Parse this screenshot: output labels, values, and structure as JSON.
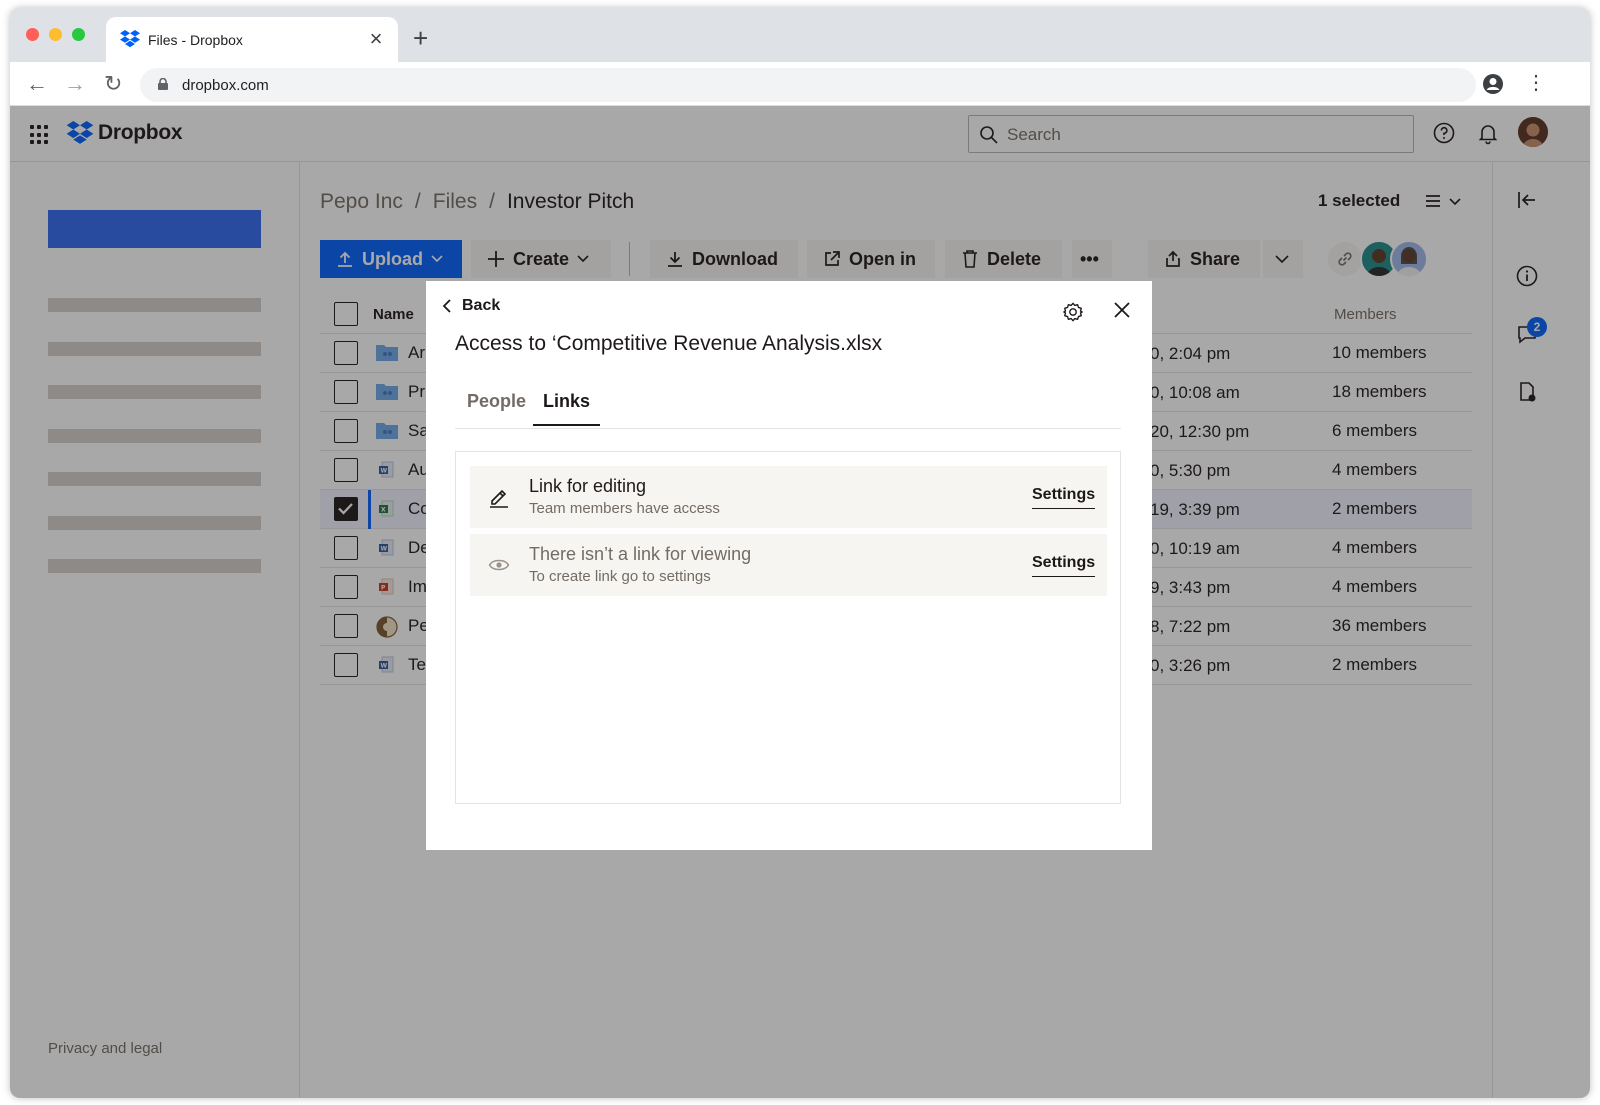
{
  "browser": {
    "tab_title": "Files - Dropbox",
    "tab_close": "×",
    "new_tab": "+",
    "url": "dropbox.com",
    "back": "←",
    "forward": "→",
    "reload": "↻",
    "menu": "⋮"
  },
  "app": {
    "brand": "Dropbox",
    "search_placeholder": "Search",
    "privacy": "Privacy and legal"
  },
  "breadcrumb": {
    "items": [
      "Pepo Inc",
      "Files",
      "Investor Pitch"
    ],
    "separator": "/"
  },
  "selection": {
    "label": "1 selected"
  },
  "toolbar": {
    "upload": "Upload",
    "create": "Create",
    "download": "Download",
    "open_in": "Open in",
    "delete": "Delete",
    "more": "•••",
    "share": "Share"
  },
  "table": {
    "col_name": "Name",
    "col_members": "Members",
    "rows": [
      {
        "name": "Ar",
        "type": "folder",
        "date": "0, 2:04 pm",
        "members": "10 members",
        "checked": false
      },
      {
        "name": "Pr",
        "type": "folder",
        "date": "0, 10:08 am",
        "members": "18 members",
        "checked": false
      },
      {
        "name": "Sa",
        "type": "folder",
        "date": "20, 12:30 pm",
        "members": "6 members",
        "checked": false
      },
      {
        "name": "Au",
        "type": "word",
        "date": "0, 5:30 pm",
        "members": "4 members",
        "checked": false
      },
      {
        "name": "Co",
        "type": "excel",
        "date": "19, 3:39 pm",
        "members": "2 members",
        "checked": true
      },
      {
        "name": "De",
        "type": "word",
        "date": "0, 10:19 am",
        "members": "4 members",
        "checked": false
      },
      {
        "name": "Im",
        "type": "ppt",
        "date": "9, 3:43 pm",
        "members": "4 members",
        "checked": false
      },
      {
        "name": "Pe",
        "type": "pepo",
        "date": "8, 7:22 pm",
        "members": "36 members",
        "checked": false
      },
      {
        "name": "Te",
        "type": "word",
        "date": "0, 3:26 pm",
        "members": "2 members",
        "checked": false
      }
    ]
  },
  "rail": {
    "comments_count": "2"
  },
  "modal": {
    "back": "Back",
    "title": "Access to ‘Competitive Revenue Analysis.xlsx",
    "tabs": [
      {
        "label": "People",
        "active": false
      },
      {
        "label": "Links",
        "active": true
      }
    ],
    "links": [
      {
        "title": "Link for editing",
        "subtitle": "Team members have access",
        "action": "Settings",
        "icon": "pencil-icon"
      },
      {
        "title": "There isn’t a link for viewing",
        "subtitle": "To create link go to settings",
        "action": "Settings",
        "icon": "eye-icon"
      }
    ]
  },
  "colors": {
    "dropbox_blue": "#0061fe",
    "overlay": "rgba(30,25,25,0.38)",
    "text": "#1e1919",
    "muted": "#736c64"
  }
}
